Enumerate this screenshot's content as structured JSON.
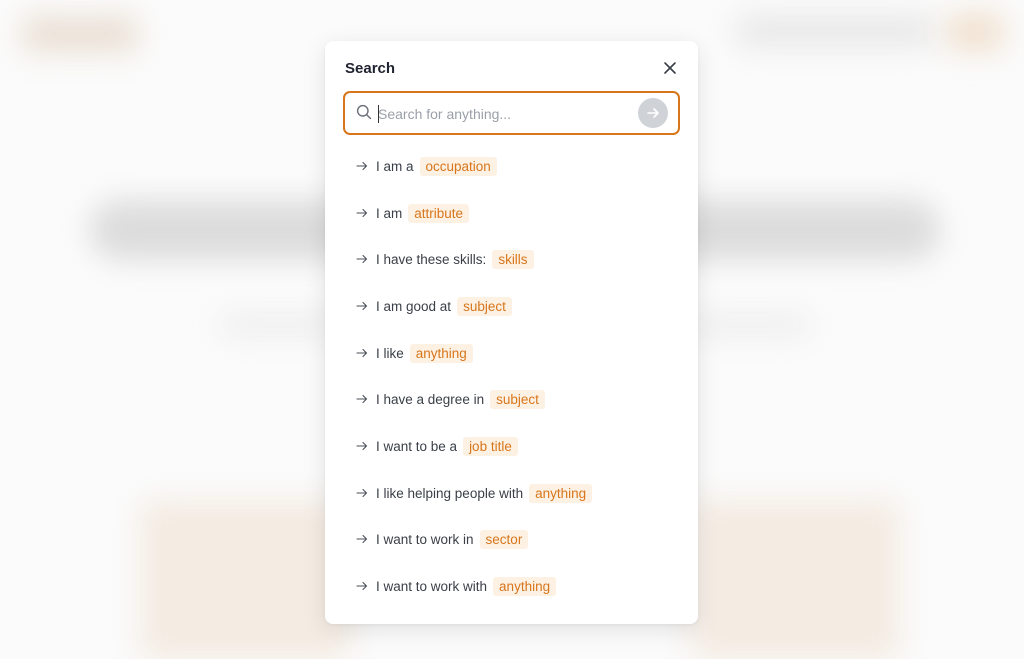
{
  "modal": {
    "title": "Search"
  },
  "search": {
    "placeholder": "Search for anything..."
  },
  "colors": {
    "accent": "#d8761b",
    "tag_bg": "#fdf1e4",
    "submit_bg": "#cfd3d8"
  },
  "icons": {
    "close": "close-icon",
    "search": "search-icon",
    "submit": "arrow-right-icon",
    "suggestion": "arrow-right-icon"
  },
  "suggestions": [
    {
      "text": "I am a",
      "tag": "occupation"
    },
    {
      "text": "I am",
      "tag": "attribute"
    },
    {
      "text": "I have these skills:",
      "tag": "skills"
    },
    {
      "text": "I am good at",
      "tag": "subject"
    },
    {
      "text": "I like",
      "tag": "anything"
    },
    {
      "text": "I have a degree in",
      "tag": "subject"
    },
    {
      "text": "I want to be a",
      "tag": "job title"
    },
    {
      "text": "I like helping people with",
      "tag": "anything"
    },
    {
      "text": "I want to work in",
      "tag": "sector"
    },
    {
      "text": "I want to work with",
      "tag": "anything"
    }
  ]
}
